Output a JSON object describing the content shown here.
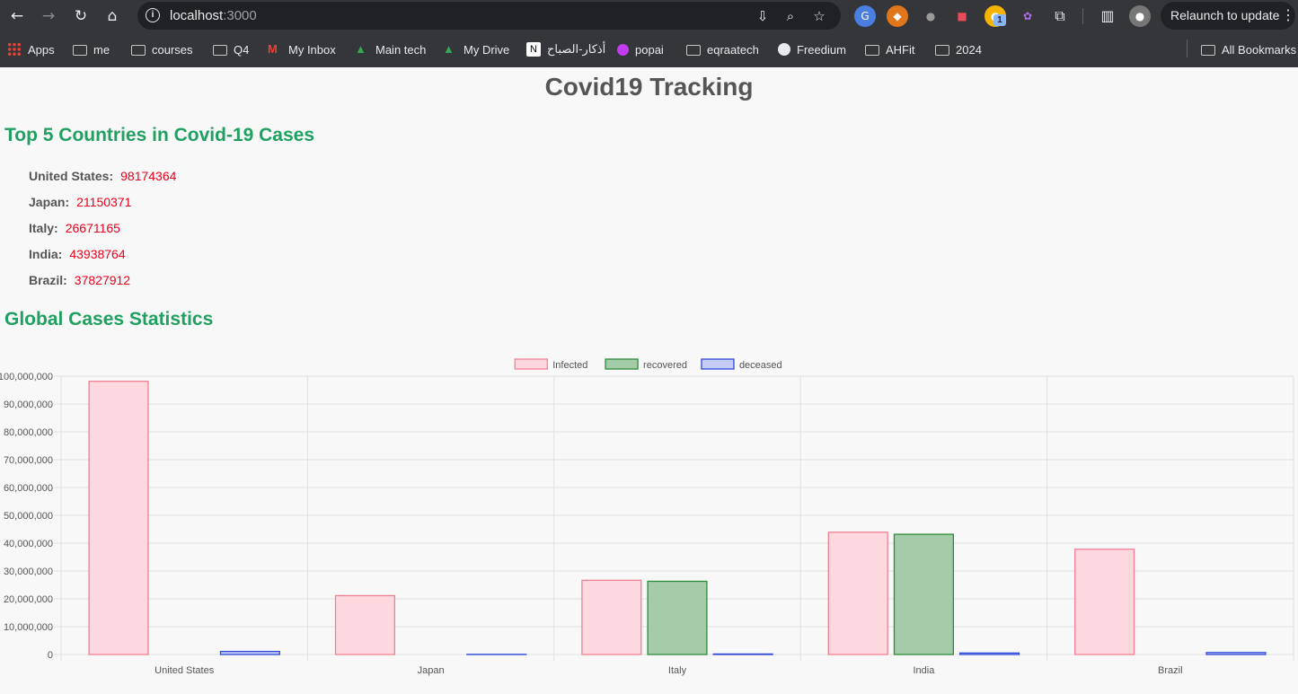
{
  "browser": {
    "url_host": "localhost",
    "url_port": ":3000",
    "relaunch_label": "Relaunch to update",
    "extension_badge": "1",
    "bookmarks": [
      {
        "label": "Apps",
        "icon": "apps-grid-icon"
      },
      {
        "label": "me",
        "icon": "folder-icon"
      },
      {
        "label": "courses",
        "icon": "folder-icon"
      },
      {
        "label": "Q4",
        "icon": "folder-icon"
      },
      {
        "label": "My Inbox",
        "icon": "gmail-icon"
      },
      {
        "label": "Main tech",
        "icon": "drive-icon"
      },
      {
        "label": "My Drive",
        "icon": "drive-icon"
      },
      {
        "label": "أذكار-الصباح",
        "icon": "notion-icon"
      },
      {
        "label": "popai",
        "icon": "popai-icon"
      },
      {
        "label": "eqraatech",
        "icon": "folder-icon"
      },
      {
        "label": "Freedium",
        "icon": "globe-icon"
      },
      {
        "label": "AHFit",
        "icon": "folder-icon"
      },
      {
        "label": "2024",
        "icon": "folder-icon"
      }
    ],
    "all_bookmarks_label": "All Bookmarks"
  },
  "page": {
    "title": "Covid19 Tracking",
    "top_section_title": "Top 5 Countries in Covid-19 Cases",
    "top_countries": [
      {
        "name": "United States:",
        "value": "98174364"
      },
      {
        "name": "Japan:",
        "value": "21150371"
      },
      {
        "name": "Italy:",
        "value": "26671165"
      },
      {
        "name": "India:",
        "value": "43938764"
      },
      {
        "name": "Brazil:",
        "value": "37827912"
      }
    ],
    "stats_section_title": "Global Cases Statistics"
  },
  "colors": {
    "accent_green": "#20a060",
    "value_red": "#e8001b",
    "infected_fill": "#fdd9df",
    "infected_border": "#f27f95",
    "recovered_fill": "#a4cca8",
    "recovered_border": "#2e8b3a",
    "deceased_fill": "#c5cdf6",
    "deceased_border": "#3048d8"
  },
  "chart_data": {
    "type": "bar",
    "categories": [
      "United States",
      "Japan",
      "Italy",
      "India",
      "Brazil"
    ],
    "series": [
      {
        "name": "Infected",
        "values": [
          98174364,
          21150371,
          26671165,
          43938764,
          37827912
        ]
      },
      {
        "name": "recovered",
        "values": [
          0,
          0,
          26300000,
          43200000,
          0
        ]
      },
      {
        "name": "deceased",
        "values": [
          1100000,
          50000,
          180000,
          525000,
          700000
        ]
      }
    ],
    "ylim": [
      0,
      100000000
    ],
    "yticks": [
      "0",
      "10,000,000",
      "20,000,000",
      "30,000,000",
      "40,000,000",
      "50,000,000",
      "60,000,000",
      "70,000,000",
      "80,000,000",
      "90,000,000",
      "100,000,000"
    ],
    "legend_position": "top",
    "grid": true
  }
}
